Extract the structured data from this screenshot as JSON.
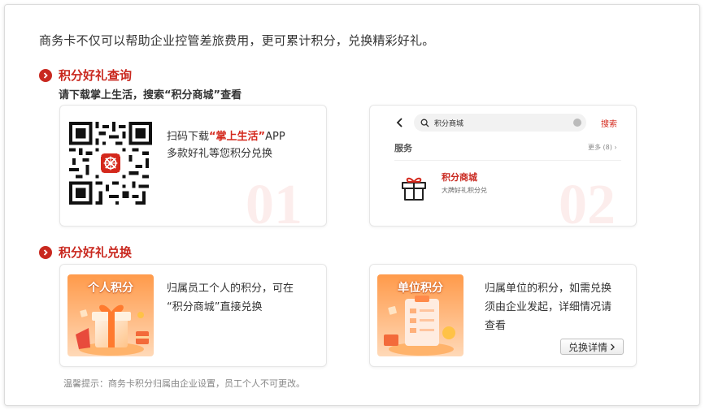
{
  "intro": "商务卡不仅可以帮助企业控管差旅费用，更可累计积分，兑换精彩好礼。",
  "section_query": {
    "title": "积分好礼查询",
    "subtitle": "请下载掌上生活，搜索“积分商城”查看"
  },
  "card_scan": {
    "text_prefix": "扫码下载",
    "app_name": "“掌上生活”",
    "text_suffix": "APP",
    "line2": "多款好礼等您积分兑换",
    "number": "01"
  },
  "card_search": {
    "search_query": "积分商城",
    "search_button": "搜索",
    "section_label": "服务",
    "more": "更多 (8) ›",
    "result_name": "积分商城",
    "result_desc": "大牌好礼积分兑",
    "number": "02"
  },
  "section_redeem": {
    "title": "积分好礼兑换"
  },
  "card_personal": {
    "badge": "个人积分",
    "line1": "归属员工个人的积分，可在",
    "line2": "“积分商城”直接兑换"
  },
  "card_company": {
    "badge": "单位积分",
    "line1": "归属单位的积分，如需兑换",
    "line2": "须由企业发起，详细情况请",
    "line3": "查看",
    "button": "兑换详情"
  },
  "tip": "温馨提示：商务卡积分归属由企业设置，员工个人不可更改。",
  "colors": {
    "accent": "#c9281f",
    "orange": "#f5883a"
  }
}
